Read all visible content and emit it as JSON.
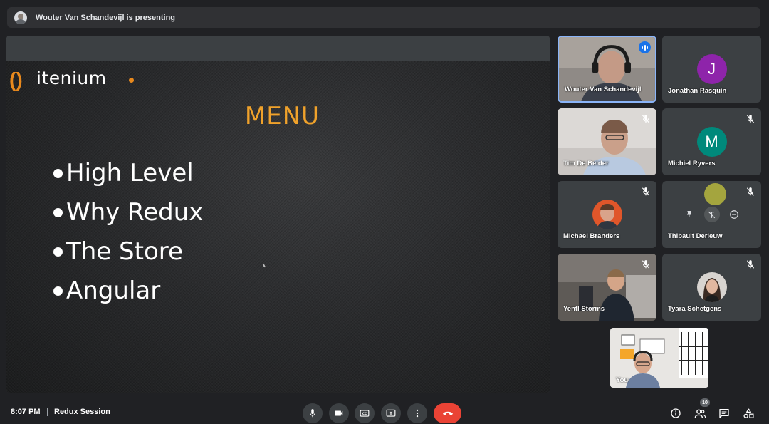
{
  "presenting_bar": {
    "text": "Wouter Van Schandevijl is presenting"
  },
  "slide": {
    "logo_mark": "()",
    "logo_text": "itenium",
    "title": "MENU",
    "bullets": [
      "High Level",
      "Why Redux",
      "The Store",
      "Angular"
    ],
    "colors": {
      "title": "#f0a22b",
      "accent": "#e8891d",
      "bullet": "#ffffff"
    }
  },
  "participants": [
    {
      "name": "Wouter Van Schandevijl",
      "type": "video",
      "speaking": true
    },
    {
      "name": "Jonathan Rasquin",
      "type": "letter",
      "letter": "J",
      "color": "#8e24aa",
      "muted": false
    },
    {
      "name": "Tim De Belder",
      "type": "video",
      "muted": true
    },
    {
      "name": "Michiel Ryvers",
      "type": "letter",
      "letter": "M",
      "color": "#00897b",
      "muted": true
    },
    {
      "name": "Michael Branders",
      "type": "photo",
      "muted": true
    },
    {
      "name": "Thibault Derieuw",
      "type": "hover",
      "muted": true
    },
    {
      "name": "Yentl Storms",
      "type": "video",
      "muted": true
    },
    {
      "name": "Tyara Schetgens",
      "type": "photo",
      "muted": true
    },
    {
      "name": "You",
      "type": "self-video"
    }
  ],
  "bottom_bar": {
    "time": "8:07 PM",
    "meeting_name": "Redux Session",
    "participant_count": "10",
    "controls": [
      "mic-icon",
      "camera-icon",
      "captions-icon",
      "present-icon",
      "more-icon",
      "end-call-icon"
    ],
    "right_controls": [
      "info-icon",
      "people-icon",
      "chat-icon",
      "activities-icon"
    ]
  }
}
